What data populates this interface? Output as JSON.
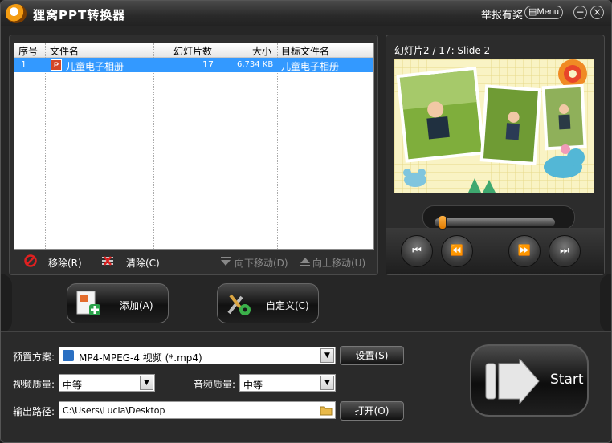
{
  "titlebar": {
    "title": "狸窝PPT转换器",
    "report": "举报有奖",
    "menu": "Menu",
    "minimize": "−",
    "close": "×"
  },
  "file_list": {
    "columns": [
      "序号",
      "文件名",
      "幻灯片数",
      "大小",
      "目标文件名"
    ],
    "rows": [
      {
        "index": "1",
        "file_name": "儿童电子相册",
        "slides": "17",
        "size": "6,734 KB",
        "target_name": "儿童电子相册"
      }
    ],
    "actions": {
      "remove": "移除(R)",
      "clear": "清除(C)",
      "move_down": "向下移动(D)",
      "move_up": "向上移动(U)"
    }
  },
  "preview": {
    "caption": "幻灯片2 / 17: Slide 2",
    "progress": 0.02
  },
  "buttons": {
    "add": "添加(A)",
    "customize": "自定义(C)"
  },
  "settings": {
    "preset_label": "预置方案:",
    "preset_value": "MP4-MPEG-4 视频 (*.mp4)",
    "settings_button": "设置(S)",
    "video_quality_label": "视频质量:",
    "video_quality_value": "中等",
    "audio_quality_label": "音频质量:",
    "audio_quality_value": "中等",
    "output_path_label": "输出路径:",
    "output_path_value": "C:\\Users\\Lucia\\Desktop",
    "open_button": "打开(O)",
    "start": "Start"
  },
  "colors": {
    "selection": "#3399ff",
    "ppt_icon": "#d24726",
    "knob": "#f39c12"
  }
}
